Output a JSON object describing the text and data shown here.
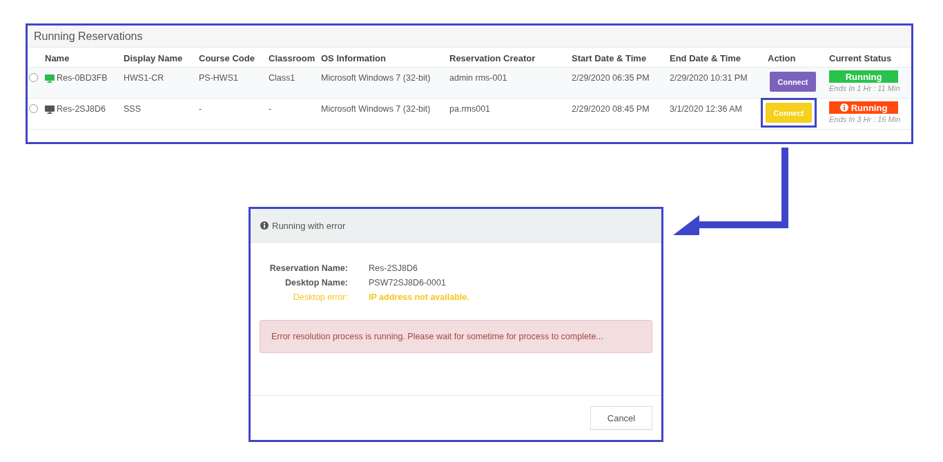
{
  "panel": {
    "title": "Running Reservations",
    "columns": [
      "Name",
      "Display Name",
      "Course Code",
      "Classroom",
      "OS Information",
      "Reservation Creator",
      "Start Date & Time",
      "End Date & Time",
      "Action",
      "Current Status"
    ],
    "rows": [
      {
        "selected": false,
        "color": "#2db84d",
        "name": "Res-0BD3FB",
        "display_name": "HWS1-CR",
        "course_code": "PS-HWS1",
        "classroom": "Class1",
        "os": "Microsoft Windows 7 (32-bit)",
        "creator": "admin rms-001",
        "start": "2/29/2020 06:35 PM",
        "end": "2/29/2020 10:31 PM",
        "action": {
          "label": "Connect",
          "kind": "primary",
          "highlighted": false
        },
        "status": {
          "label": "Running",
          "kind": "ok",
          "note": "Ends In 1 Hr : 11 Min"
        }
      },
      {
        "selected": false,
        "color": "#555555",
        "name": "Res-2SJ8D6",
        "display_name": "SSS",
        "course_code": "-",
        "classroom": "-",
        "os": "Microsoft Windows 7 (32-bit)",
        "creator": "pa.rms001",
        "start": "2/29/2020 08:45 PM",
        "end": "3/1/2020 12:36 AM",
        "action": {
          "label": "Connect",
          "kind": "warning",
          "highlighted": true
        },
        "status": {
          "label": "Running",
          "kind": "error",
          "note": "Ends In 3 Hr : 16 Min"
        }
      }
    ]
  },
  "dialog": {
    "title": "Running with error",
    "fields": [
      {
        "label": "Reservation Name:",
        "value": "Res-2SJ8D6",
        "kind": "normal"
      },
      {
        "label": "Desktop Name:",
        "value": "PSW72SJ8D6-0001",
        "kind": "normal"
      },
      {
        "label": "Desktop error:",
        "value": "IP address not available.",
        "kind": "error"
      }
    ],
    "alert": "Error resolution process is running. Please wait for sometime for process to complete...",
    "buttons": [
      "Cancel"
    ]
  }
}
